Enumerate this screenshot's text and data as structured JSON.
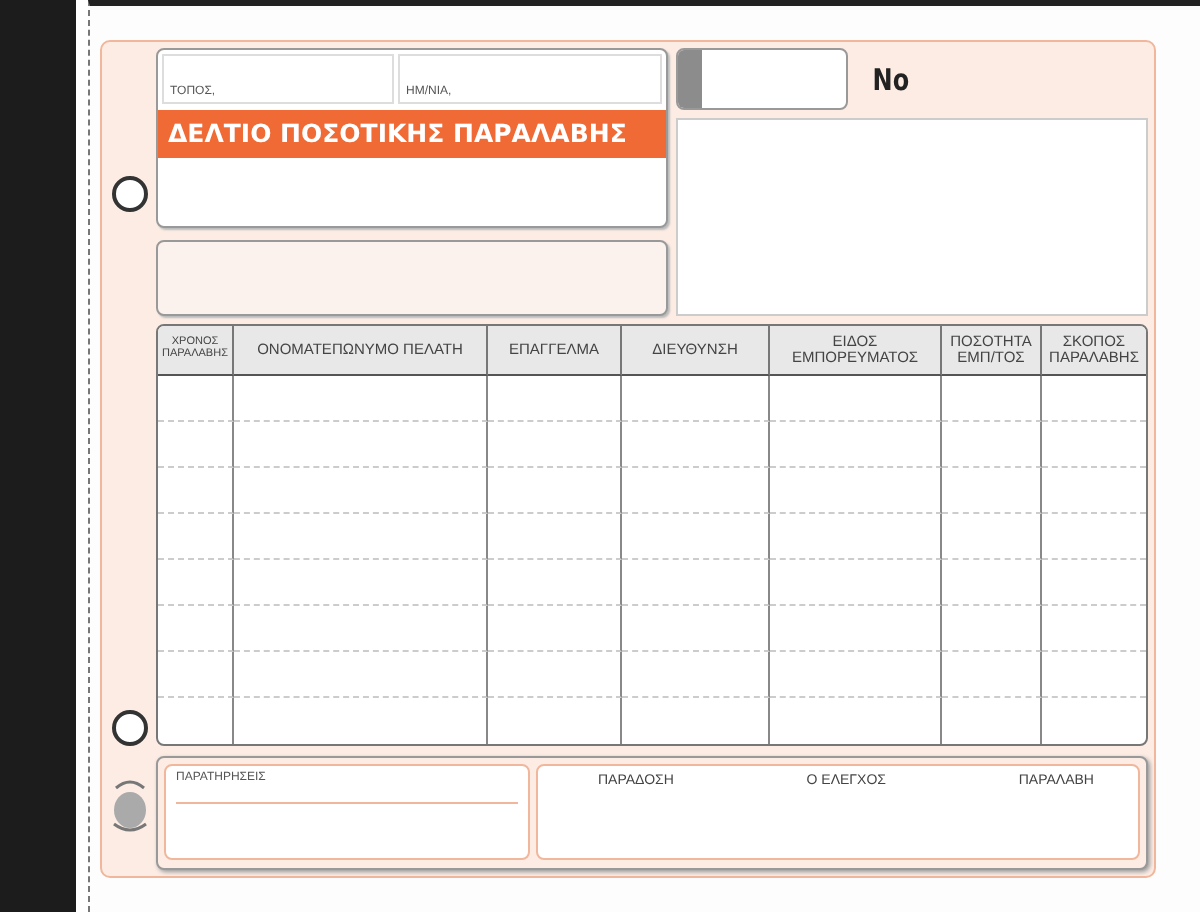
{
  "header": {
    "place_label": "ΤΟΠΟΣ,",
    "date_label": "ΗΜ/ΝΙΑ,",
    "title": "ΔΕΛΤΙΟ ΠΟΣΟΤΙΚΗΣ ΠΑΡΑΛΑΒΗΣ"
  },
  "number_label": "No",
  "table": {
    "columns": [
      {
        "label": "ΧΡΟΝΟΣ ΠΑΡΑΛΑΒΗΣ"
      },
      {
        "label": "ΟΝΟΜΑΤΕΠΩΝΥΜΟ ΠΕΛΑΤΗ"
      },
      {
        "label": "ΕΠΑΓΓΕΛΜΑ"
      },
      {
        "label": "ΔΙΕΥΘΥΝΣΗ"
      },
      {
        "label": "ΕΙΔΟΣ ΕΜΠΟΡΕΥΜΑΤΟΣ"
      },
      {
        "label": "ΠΟΣΟΤΗΤΑ ΕΜΠ/ΤΟΣ"
      },
      {
        "label": "ΣΚΟΠΟΣ ΠΑΡΑΛΑΒΗΣ"
      }
    ]
  },
  "footer": {
    "remarks_label": "ΠΑΡΑΤΗΡΗΣΕΙΣ",
    "signatures": [
      "ΠΑΡΑΔΟΣΗ",
      "Ο ΕΛΕΓΧΟΣ",
      "ΠΑΡΑΛΑΒΗ"
    ]
  }
}
